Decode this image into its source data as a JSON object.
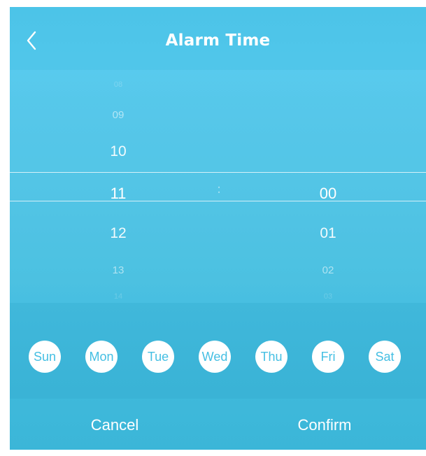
{
  "header": {
    "title": "Alarm Time",
    "back_icon": "chevron-left-icon"
  },
  "picker": {
    "hours": [
      "08",
      "09",
      "10",
      "11",
      "12",
      "13",
      "14"
    ],
    "selected_hour": "11",
    "separator": ":",
    "minutes": [
      "00",
      "01",
      "02",
      "03"
    ],
    "selected_minute": "00"
  },
  "days": [
    "Sun",
    "Mon",
    "Tue",
    "Wed",
    "Thu",
    "Fri",
    "Sat"
  ],
  "footer": {
    "cancel_label": "Cancel",
    "confirm_label": "Confirm"
  },
  "colors": {
    "background": "#4cc4e8",
    "day_text": "#45bfe3",
    "text": "#ffffff"
  }
}
